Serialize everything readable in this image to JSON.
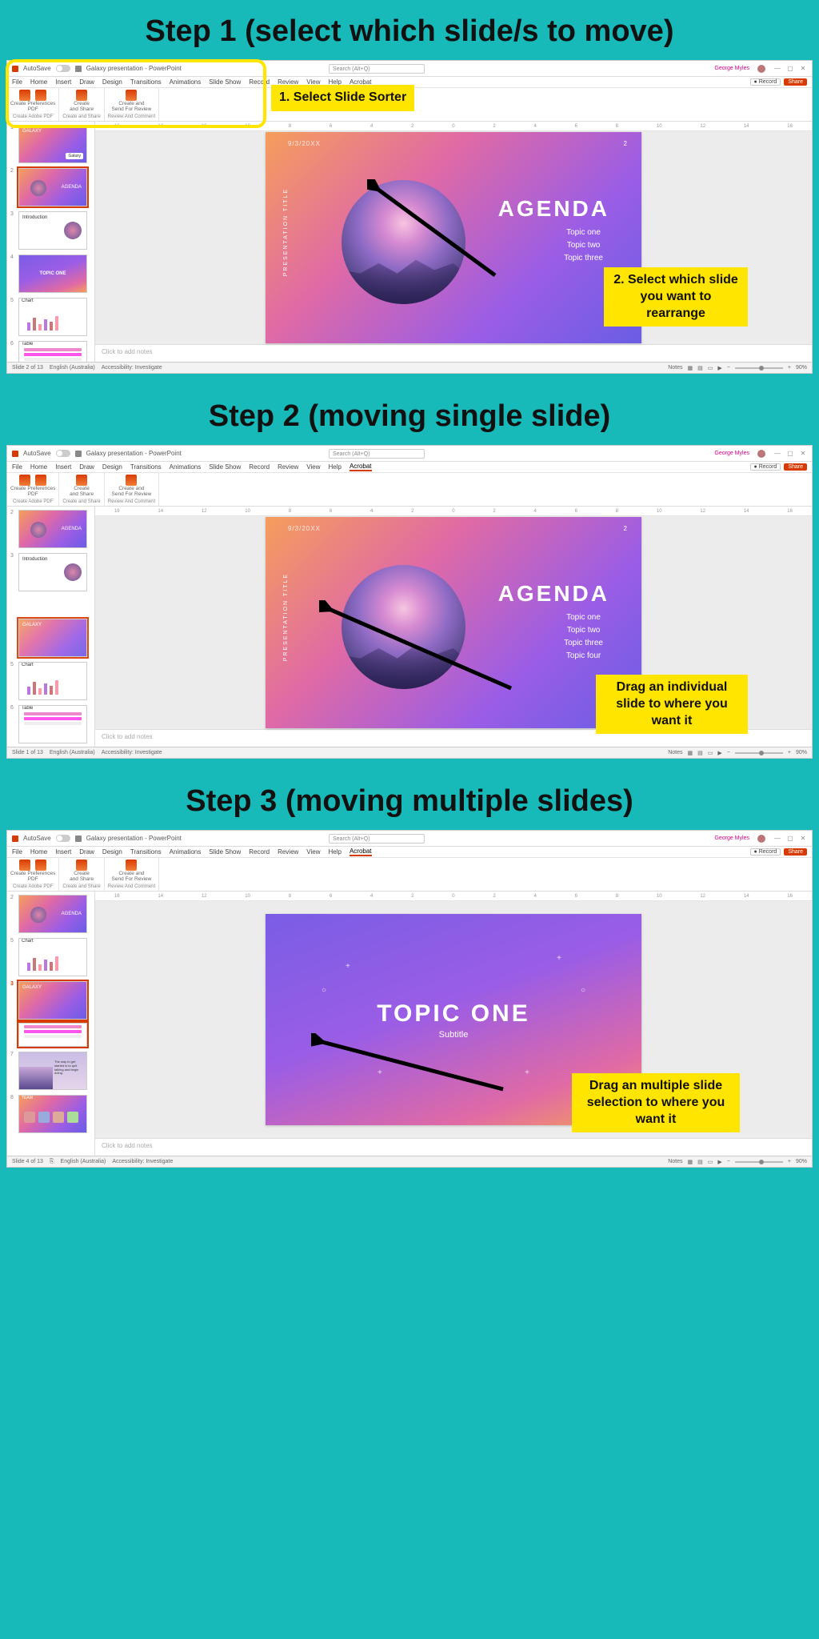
{
  "steps": {
    "s1": {
      "title": "Step 1 (select which slide/s to move)"
    },
    "s2": {
      "title": "Step 2 (moving single slide)"
    },
    "s3": {
      "title": "Step 3 (moving multiple slides)"
    }
  },
  "callouts": {
    "c1a": "1.   Select Slide Sorter",
    "c1b": "2. Select which slide you want to rearrange",
    "c2": "Drag an individual slide to where you want it",
    "c3": "Drag an multiple slide selection to where you want it"
  },
  "titlebar": {
    "autosave": "AutoSave",
    "doc": "Galaxy presentation - PowerPoint",
    "search": "Search (Alt+Q)",
    "user": "George Myles"
  },
  "menu": {
    "items": [
      "File",
      "Home",
      "Insert",
      "Draw",
      "Design",
      "Transitions",
      "Animations",
      "Slide Show",
      "Record",
      "Review",
      "View",
      "Help",
      "Acrobat"
    ],
    "record": "Record",
    "share": "Share"
  },
  "ribbon": {
    "g1": {
      "l1": "Create",
      "l2": "PDF",
      "cap": "Create Adobe PDF"
    },
    "g1b": {
      "l1": "Preferences",
      "l2": ""
    },
    "g2": {
      "l1": "Create",
      "l2": "and Share",
      "cap": "Create and Share"
    },
    "g3": {
      "l1": "Create and",
      "l2": "Send For Review",
      "cap": "Review And Comment"
    }
  },
  "ruler": [
    "16",
    "14",
    "12",
    "10",
    "8",
    "6",
    "4",
    "2",
    "0",
    "2",
    "4",
    "6",
    "8",
    "10",
    "12",
    "14",
    "16"
  ],
  "slide": {
    "date": "9/3/20XX",
    "pg": "2",
    "vtitle": "PRESENTATION TITLE",
    "agenda": "AGENDA",
    "topics3": [
      "Topic one",
      "Topic two",
      "Topic three"
    ],
    "topics4": [
      "Topic one",
      "Topic two",
      "Topic three",
      "Topic four"
    ],
    "topicone": "TOPIC ONE",
    "subtitle": "Subtitle"
  },
  "notes": "Click to add notes",
  "status": {
    "s1": "Slide 2 of 13",
    "s2": "Slide 1 of 13",
    "s3": "Slide 4 of 13",
    "lang": "English (Australia)",
    "acc": "Accessibility: Investigate",
    "notes": "Notes",
    "zoom": "90%"
  },
  "thumbs": {
    "galaxy": "GALAXY",
    "galaxytag": "Galaxy",
    "agenda": "AGENDA",
    "intro": "Introduction",
    "topic": "TOPIC ONE",
    "chart": "Chart",
    "table": "Table",
    "team": "TEAM"
  }
}
